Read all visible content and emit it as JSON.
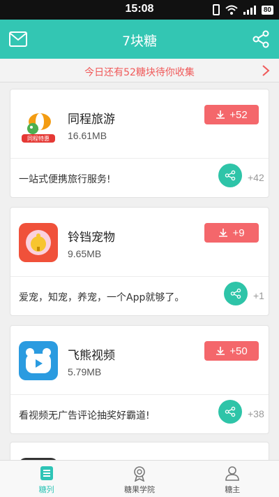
{
  "status_bar": {
    "time": "15:08",
    "battery": "80"
  },
  "header": {
    "title": "7块糖",
    "left_icon": "mail-icon",
    "right_icon": "share-icon"
  },
  "banner": {
    "text": "今日还有52糖块待你收集"
  },
  "apps": [
    {
      "name": "同程旅游",
      "size": "16.61MB",
      "download_label": "+52",
      "description": "一站式便携旅行服务!",
      "share_count": "+42",
      "icon_caption": "同程特惠"
    },
    {
      "name": "铃铛宠物",
      "size": "9.65MB",
      "download_label": "+9",
      "description": "爱宠，知宠，养宠，一个App就够了。",
      "share_count": "+1"
    },
    {
      "name": "飞熊视频",
      "size": "5.79MB",
      "download_label": "+50",
      "description": "看视频无广告评论抽奖好霸道!",
      "share_count": "+38"
    }
  ],
  "tabs": [
    {
      "label": "糖列",
      "icon": "list-icon",
      "active": true
    },
    {
      "label": "糖果学院",
      "icon": "badge-icon",
      "active": false
    },
    {
      "label": "糖主",
      "icon": "user-icon",
      "active": false
    }
  ],
  "colors": {
    "accent": "#33c6b3",
    "download": "#f4676b",
    "banner_text": "#f05a5a"
  }
}
